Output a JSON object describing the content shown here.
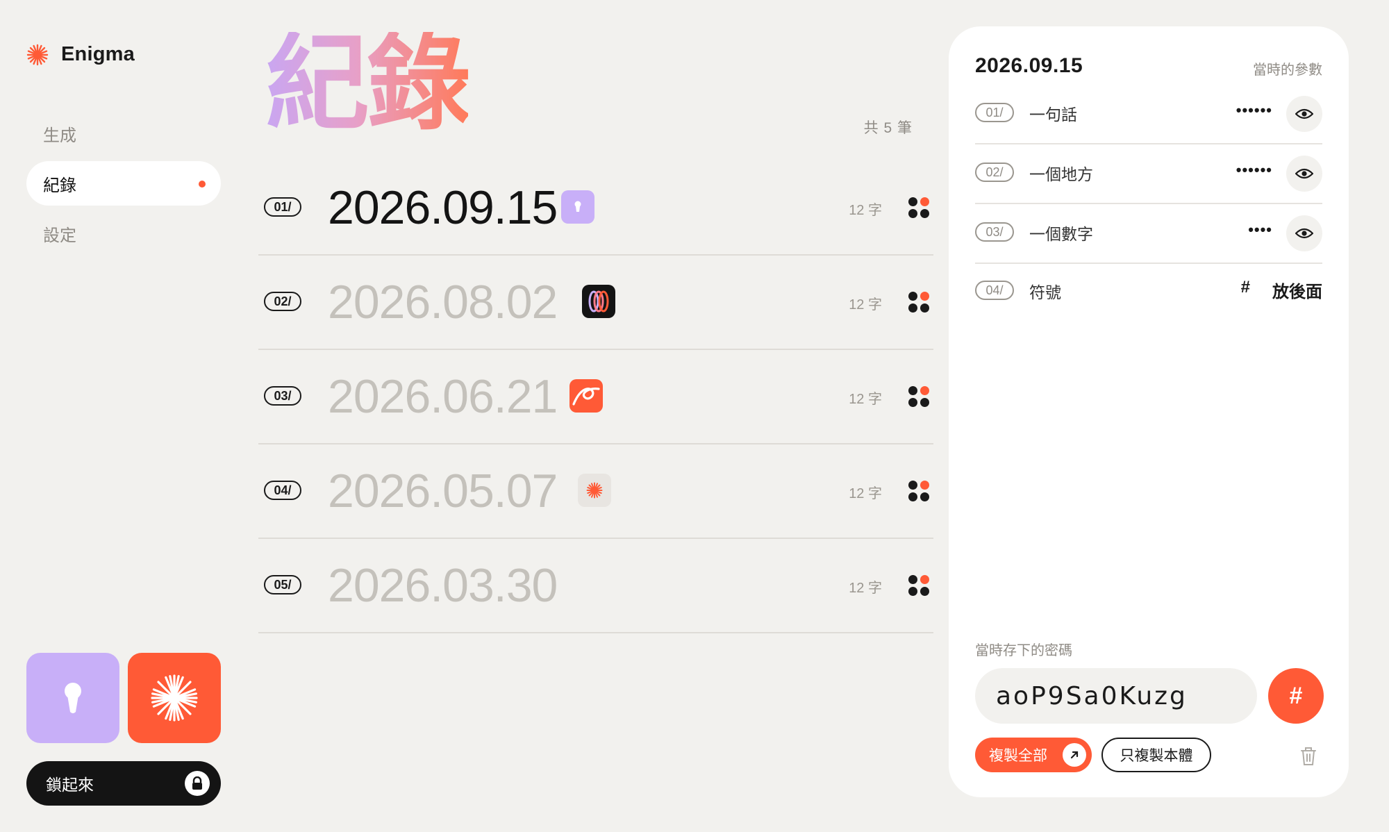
{
  "brand": {
    "name": "Enigma",
    "icon": "sunburst-icon",
    "accent": "#ff5a36"
  },
  "nav": [
    {
      "label": "生成",
      "active": false
    },
    {
      "label": "紀錄",
      "active": true
    },
    {
      "label": "設定",
      "active": false
    }
  ],
  "sidebar": {
    "lock_label": "鎖起來"
  },
  "main": {
    "title": "紀錄",
    "count": "共 5 筆",
    "records": [
      {
        "index": "01/",
        "date": "2026.09.15",
        "chars": "12 字",
        "badge": "keyhole-badge",
        "active": true
      },
      {
        "index": "02/",
        "date": "2026.08.02",
        "chars": "12 字",
        "badge": "rings-badge",
        "active": false
      },
      {
        "index": "03/",
        "date": "2026.06.21",
        "chars": "12 字",
        "badge": "scribble-badge",
        "active": false
      },
      {
        "index": "04/",
        "date": "2026.05.07",
        "chars": "12 字",
        "badge": "sunburst-badge",
        "active": false
      },
      {
        "index": "05/",
        "date": "2026.03.30",
        "chars": "12 字",
        "badge": "",
        "active": false
      }
    ]
  },
  "detail": {
    "date": "2026.09.15",
    "params_label": "當時的參數",
    "params": [
      {
        "index": "01/",
        "label": "一句話",
        "value": "••••••"
      },
      {
        "index": "02/",
        "label": "一個地方",
        "value": "••••••"
      },
      {
        "index": "03/",
        "label": "一個數字",
        "value": "••••"
      },
      {
        "index": "04/",
        "label": "符號",
        "symbol": "#",
        "position": "放後面"
      }
    ],
    "saved_label": "當時存下的密碼",
    "password": "aoP9Sa0Kuzg",
    "symbol_button": "#",
    "copy_all": "複製全部",
    "copy_body": "只複製本體"
  }
}
